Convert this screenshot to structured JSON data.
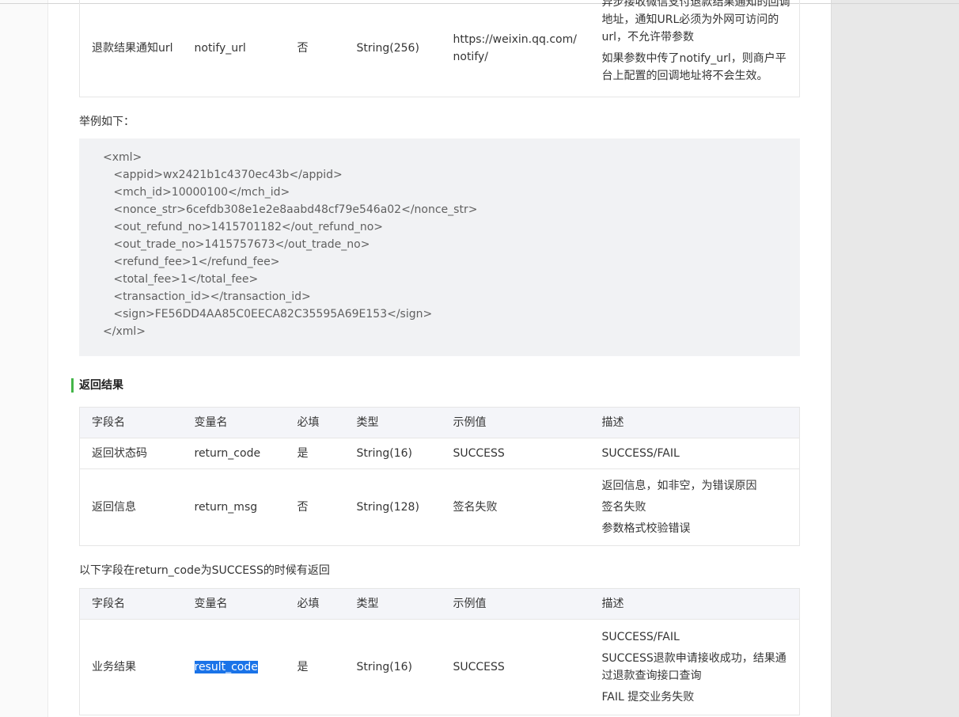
{
  "top_row": {
    "field": "退款结果通知url",
    "name": "notify_url",
    "required": "否",
    "type": "String(256)",
    "example": "https://weixin.qq.com/notify/",
    "desc": [
      "异步接收微信支付退款结果通知的回调地址，通知URL必须为外网可访问的url，不允许带参数",
      "如果参数中传了notify_url，则商户平台上配置的回调地址将不会生效。"
    ]
  },
  "example_label": "举例如下：",
  "code_lines": [
    "<xml>",
    "   <appid>wx2421b1c4370ec43b</appid>",
    "   <mch_id>10000100</mch_id>",
    "   <nonce_str>6cefdb308e1e2e8aabd48cf79e546a02</nonce_str>",
    "   <out_refund_no>1415701182</out_refund_no>",
    "   <out_trade_no>1415757673</out_trade_no>",
    "   <refund_fee>1</refund_fee>",
    "   <total_fee>1</total_fee>",
    "   <transaction_id></transaction_id>",
    "   <sign>FE56DD4AA85C0EECA82C35595A69E153</sign>",
    "</xml>"
  ],
  "section_title": "返回结果",
  "headers": [
    "字段名",
    "变量名",
    "必填",
    "类型",
    "示例值",
    "描述"
  ],
  "return_rows": [
    {
      "field": "返回状态码",
      "name": "return_code",
      "required": "是",
      "type": "String(16)",
      "example": "SUCCESS",
      "desc": [
        "SUCCESS/FAIL"
      ]
    },
    {
      "field": "返回信息",
      "name": "return_msg",
      "required": "否",
      "type": "String(128)",
      "example": "签名失败",
      "desc": [
        "返回信息，如非空，为错误原因",
        "签名失败",
        "参数格式校验错误"
      ]
    }
  ],
  "note": "以下字段在return_code为SUCCESS的时候有返回",
  "result_row": {
    "field": "业务结果",
    "name": "result_code",
    "required": "是",
    "type": "String(16)",
    "example": "SUCCESS",
    "desc": [
      "SUCCESS/FAIL",
      "SUCCESS退款申请接收成功，结果通过退款查询接口查询",
      "FAIL 提交业务失败"
    ]
  },
  "colors": {
    "accent": "#44b549",
    "selection": "#1a73e8",
    "code_bg": "#f1f2f4",
    "header_bg": "#f4f5f9"
  }
}
